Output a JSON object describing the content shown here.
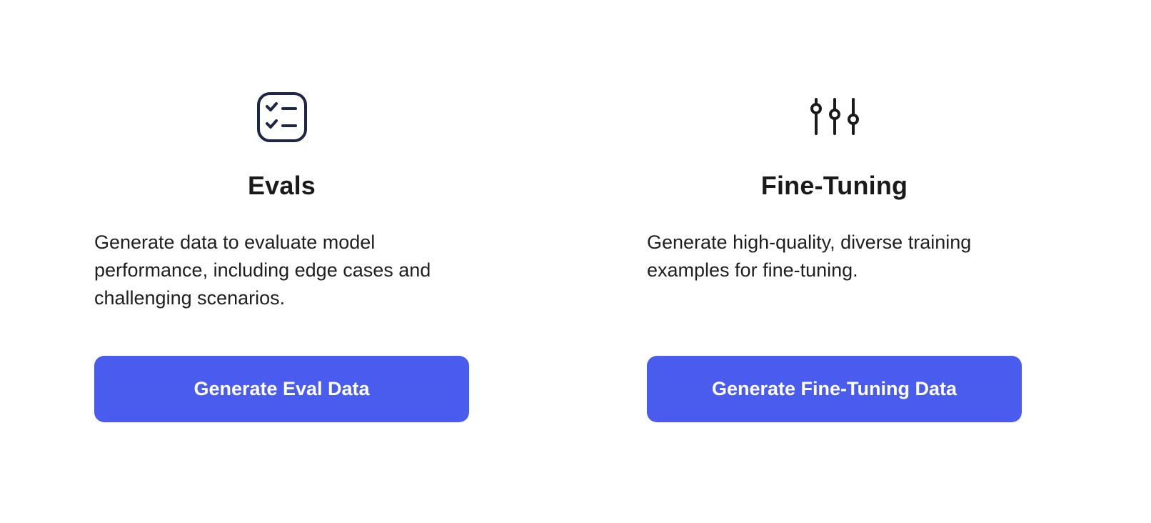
{
  "cards": [
    {
      "icon": "checklist-icon",
      "title": "Evals",
      "description": "Generate data to evaluate model performance, including edge cases and challenging scenarios.",
      "button_label": "Generate Eval Data"
    },
    {
      "icon": "sliders-icon",
      "title": "Fine-Tuning",
      "description": "Generate high-quality, diverse training examples for fine-tuning.",
      "button_label": "Generate Fine-Tuning Data"
    }
  ],
  "colors": {
    "accent": "#4a5ced",
    "icon_checklist": "#1e2545",
    "icon_sliders": "#1a1a1a"
  }
}
